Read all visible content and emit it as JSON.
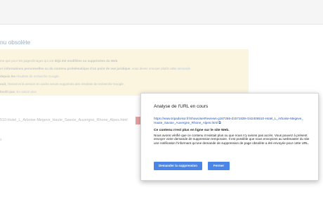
{
  "page": {
    "title": "nu obsolète"
  },
  "info": {
    "line1": {
      "pre": "me que pour les pages/images qui ont ",
      "bold": "déjà été modifiées ou supprimées du Web",
      "post": "."
    },
    "line2": {
      "pre": "es ",
      "bold": "informations personnelles ou du contenu problématique d'un point de vue juridique",
      "post": ", vous devez envoyer plutôt cette ",
      "link": "demande"
    },
    "line3": {
      "bold": "depuis les ",
      "link": "résultats de recherche Google",
      "post": "."
    },
    "line4": {
      "bold": "ouit",
      "post": ", l'extrait et la version en cache seront supprimés des résultats de recherche Google."
    },
    "line5": {
      "bold": "bsolit pas",
      "post": ". ",
      "link": "En savoir plus"
    }
  },
  "url_field": {
    "value": "510-Hotel_L_Arboise-Megeve_Haute_Savoie_Auvergne_Rhone_Alpes.html"
  },
  "bg_mark": "s",
  "dialog": {
    "title": "Analyse de l'URL en cours",
    "url": "https://www.tripadvisor.fr/ShowUserReviews-g187266-d1571839-r342406510-Hotel_L_Arboise-Megeve_Haute_Savoie_Auvergne_Rhone_Alpes.html",
    "url_icon": "external-link-icon",
    "heading": "Ce contenu n'est plus en ligne sur le site Web.",
    "body": "Nous avons vérifié que ce contenu n'existait plus ou que nous n'y avions pas accès. Vous pouvez à présent envoyer votre demande de suppression temporaire. Il est possible que nous envoyions au webmaster du site une notification l'informant qu'une demande de suppression de page obsolète a été envoyée pour cette URL.",
    "request_button": "Demander la suppression",
    "close_button": "Fermer"
  },
  "colors": {
    "primary_button": "#4a86e8",
    "link": "#1a57c8",
    "info_background": "#fbf4de"
  }
}
